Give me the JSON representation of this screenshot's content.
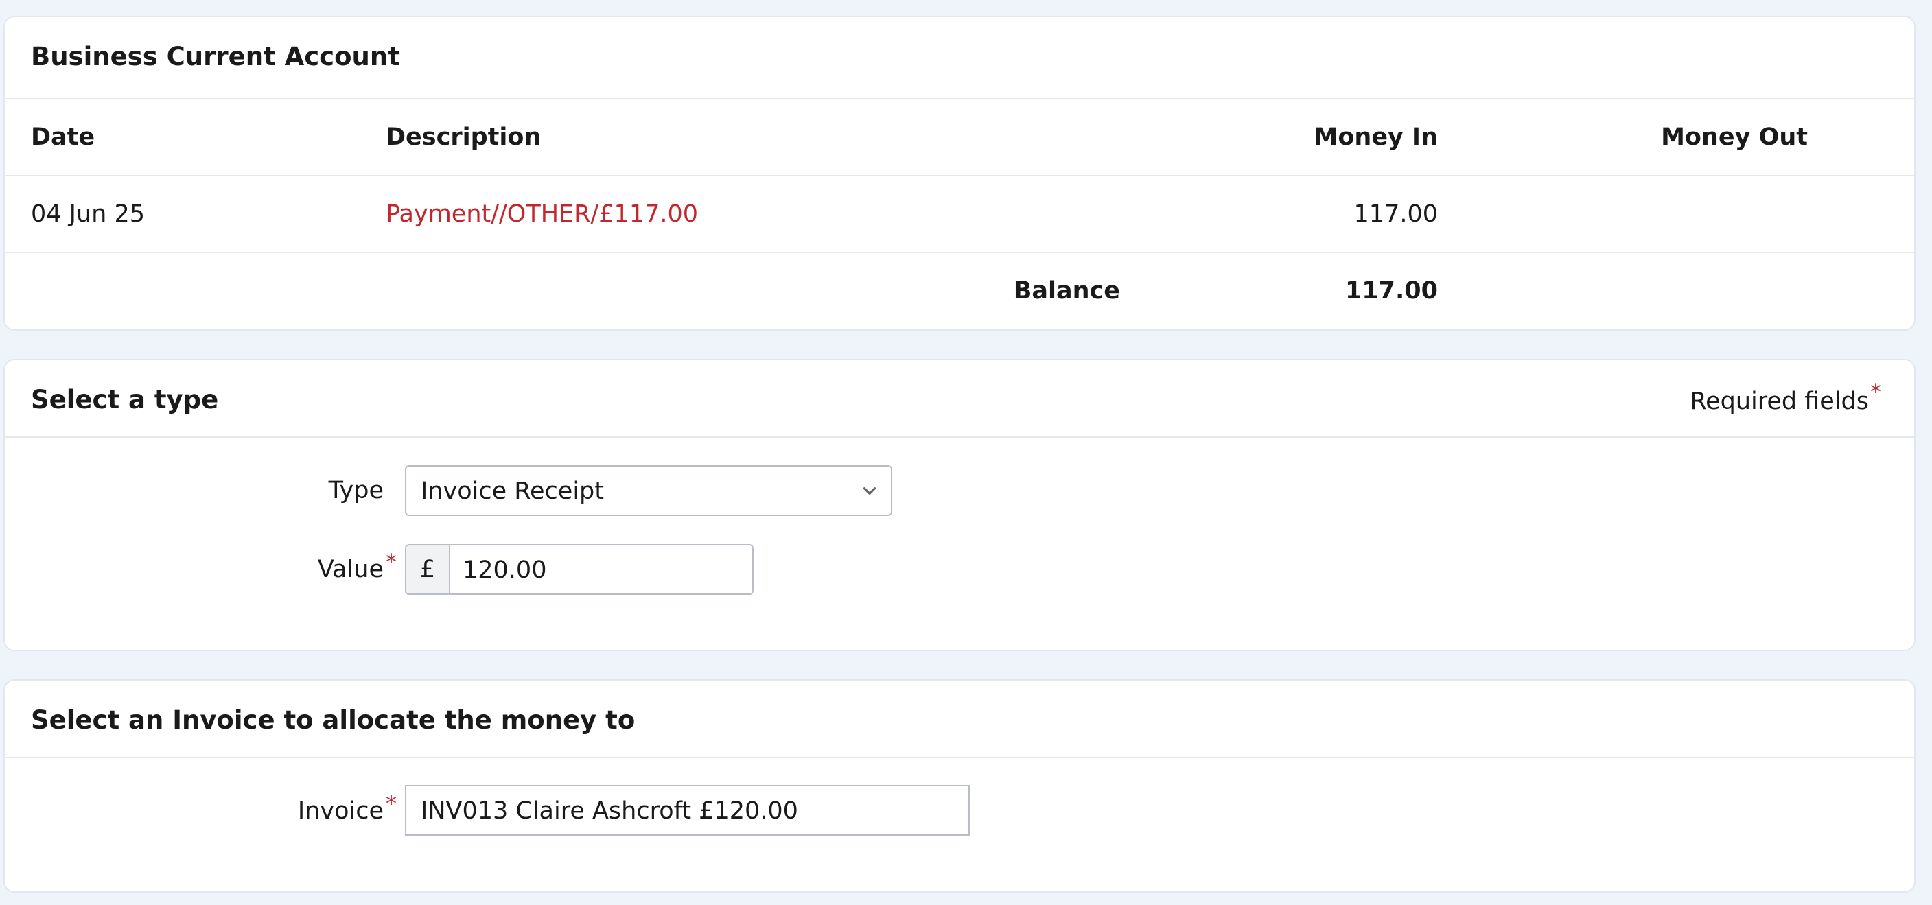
{
  "account": {
    "title": "Business Current Account",
    "columns": {
      "date": "Date",
      "description": "Description",
      "money_in": "Money In",
      "money_out": "Money Out"
    },
    "rows": [
      {
        "date": "04 Jun 25",
        "description": "Payment//OTHER/£117.00",
        "money_in": "117.00",
        "money_out": ""
      }
    ],
    "balance_label": "Balance",
    "balance_value": "117.00"
  },
  "type_section": {
    "title": "Select a type",
    "required_note": "Required fields",
    "required_marker": "*",
    "type_label": "Type",
    "type_value": "Invoice Receipt",
    "value_label": "Value",
    "currency_symbol": "£",
    "value": "120.00"
  },
  "invoice_section": {
    "title": "Select an Invoice to allocate the money to",
    "invoice_label": "Invoice",
    "required_marker": "*",
    "invoice_value": "INV013 Claire Ashcroft £120.00"
  },
  "colors": {
    "accent_red": "#c1272d",
    "page_background": "#eff3fa",
    "border": "#e3e7ee"
  },
  "icons": {
    "select_arrow": "chevron-down-icon"
  }
}
